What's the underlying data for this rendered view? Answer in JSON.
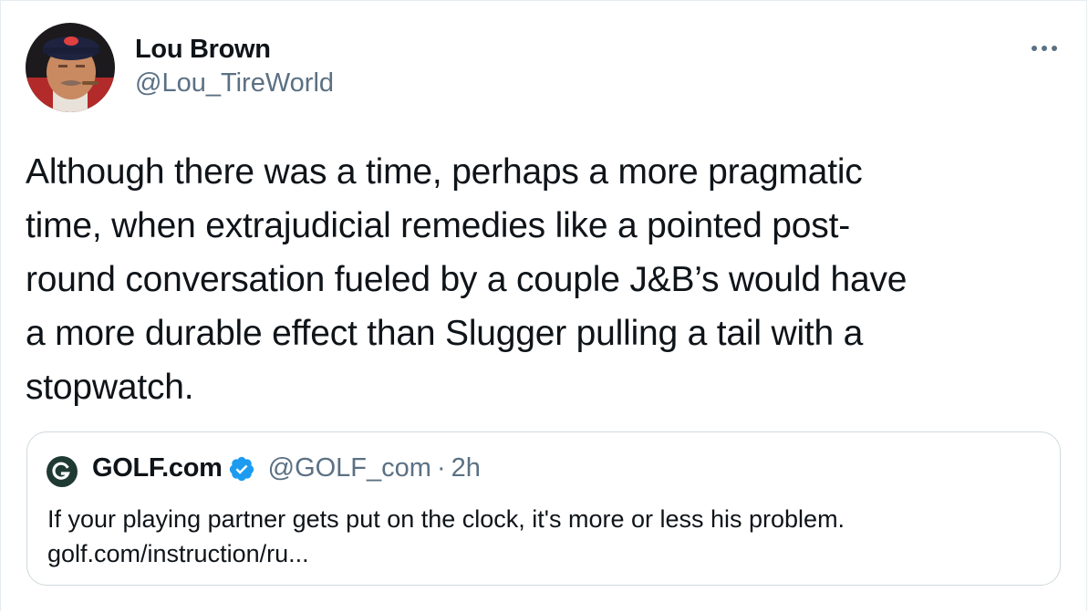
{
  "author": {
    "display_name": "Lou Brown",
    "handle": "@Lou_TireWorld"
  },
  "tweet": {
    "text": "Although there was a time, perhaps a more pragmatic\ntime, when extrajudicial remedies like a pointed post-\nround conversation fueled by a couple J&B’s would have\na more durable effect than Slugger pulling a tail with a\nstopwatch."
  },
  "quoted_tweet": {
    "display_name": "GOLF.com",
    "handle": "@GOLF_com",
    "separator": "·",
    "time": "2h",
    "text": "If your playing partner gets put on the clock, it's more or less his problem.",
    "link": "golf.com/instruction/ru..."
  },
  "icons": {
    "more": "more-horizontal-icon",
    "verified": "verified-badge-icon",
    "logo": "golf-com-logo"
  },
  "colors": {
    "text_primary": "#0f1419",
    "text_secondary": "#5b7083",
    "verified_blue": "#1d9bf0",
    "border": "#cfd9de"
  }
}
